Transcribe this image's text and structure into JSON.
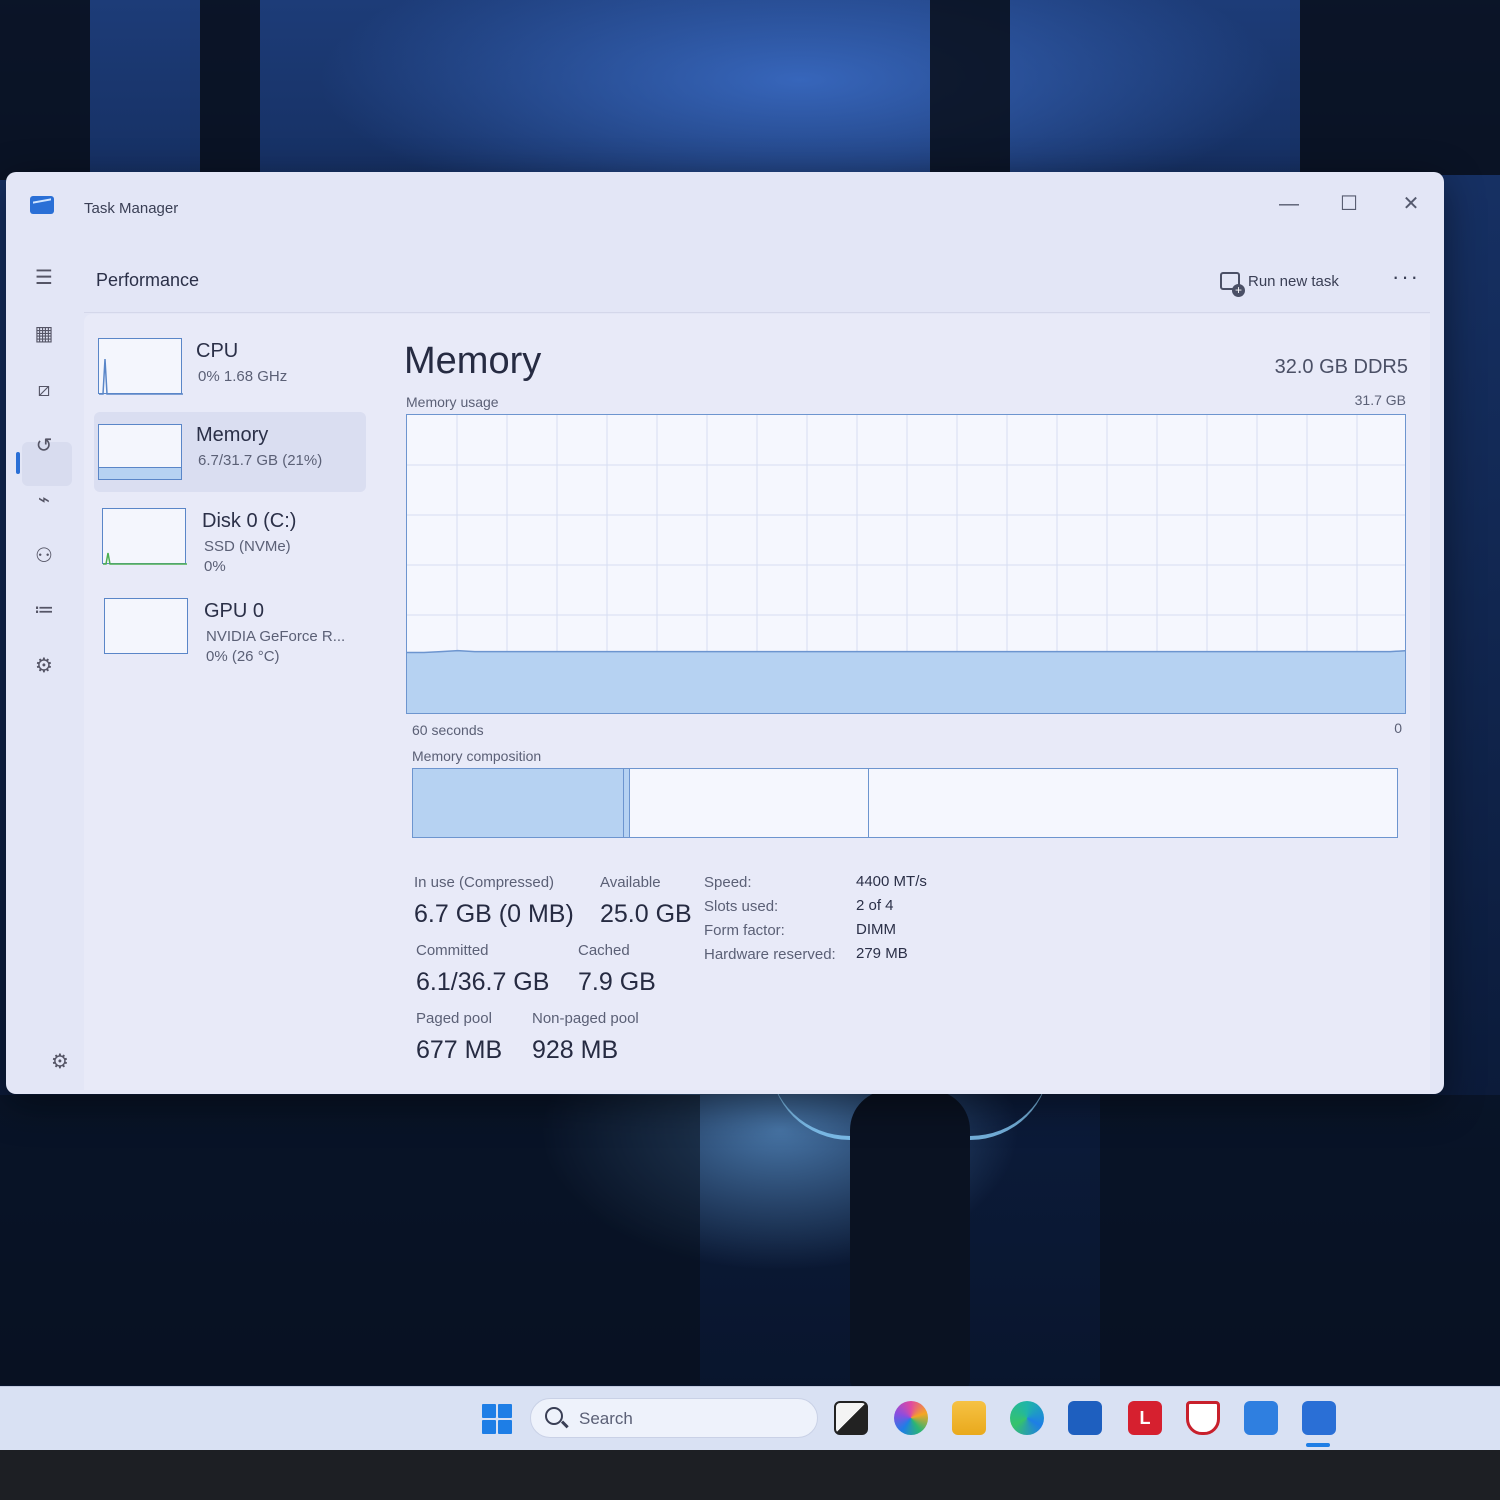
{
  "window": {
    "title": "Task Manager",
    "minimize": "—",
    "maximize": "☐",
    "close": "✕"
  },
  "header": {
    "page_title": "Performance",
    "run_new_task": "Run new task",
    "more": "···"
  },
  "nav": {
    "icons": [
      "hamburger-icon",
      "processes-icon",
      "performance-icon",
      "app-history-icon",
      "startup-apps-icon",
      "users-icon",
      "details-icon",
      "services-icon"
    ],
    "settings_icon": "settings-icon",
    "active": "performance-icon"
  },
  "devices": [
    {
      "name": "CPU",
      "sub1": "0% 1.68 GHz",
      "sub2": ""
    },
    {
      "name": "Memory",
      "sub1": "6.7/31.7 GB (21%)",
      "sub2": "",
      "selected": true
    },
    {
      "name": "Disk 0 (C:)",
      "sub1": "SSD (NVMe)",
      "sub2": "0%"
    },
    {
      "name": "GPU 0",
      "sub1": "NVIDIA GeForce R...",
      "sub2": "0% (26 °C)"
    }
  ],
  "memory": {
    "title": "Memory",
    "spec": "32.0 GB DDR5",
    "usage_label": "Memory usage",
    "usage_max": "31.7 GB",
    "time_left": "60 seconds",
    "time_right": "0",
    "composition_label": "Memory composition",
    "composition": {
      "in_use_fraction": 0.214,
      "modified_fraction": 0.006,
      "standby_fraction": 0.242
    },
    "stats": {
      "in_use_label": "In use (Compressed)",
      "in_use_value": "6.7 GB (0 MB)",
      "available_label": "Available",
      "available_value": "25.0 GB",
      "committed_label": "Committed",
      "committed_value": "6.1/36.7 GB",
      "cached_label": "Cached",
      "cached_value": "7.9 GB",
      "paged_label": "Paged pool",
      "paged_value": "677 MB",
      "nonpaged_label": "Non-paged pool",
      "nonpaged_value": "928 MB"
    },
    "props": {
      "speed_label": "Speed:",
      "speed_value": "4400 MT/s",
      "slots_label": "Slots used:",
      "slots_value": "2 of 4",
      "form_label": "Form factor:",
      "form_value": "DIMM",
      "hw_label": "Hardware reserved:",
      "hw_value": "279 MB"
    }
  },
  "chart_data": {
    "type": "area",
    "title": "Memory usage",
    "xlabel": "",
    "ylabel": "",
    "x_range_seconds": [
      60,
      0
    ],
    "ylim": [
      0,
      31.7
    ],
    "series": [
      {
        "values": [
          6.6,
          6.6,
          6.7,
          6.8,
          6.7,
          6.7,
          6.7,
          6.7,
          6.7,
          6.7,
          6.7,
          6.7,
          6.7,
          6.7,
          6.7,
          6.7,
          6.7,
          6.7,
          6.7,
          6.7,
          6.7,
          6.7,
          6.7,
          6.7,
          6.7,
          6.7,
          6.7,
          6.7,
          6.7,
          6.7,
          6.7,
          6.7,
          6.7,
          6.7,
          6.7,
          6.7,
          6.7,
          6.7,
          6.7,
          6.7,
          6.7,
          6.7,
          6.7,
          6.7,
          6.7,
          6.7,
          6.7,
          6.7,
          6.7,
          6.7,
          6.7,
          6.7,
          6.7,
          6.7,
          6.7,
          6.7,
          6.7,
          6.7,
          6.7,
          6.8
        ]
      }
    ],
    "grid": true
  },
  "taskbar": {
    "search_placeholder": "Search",
    "icons": [
      "start-icon",
      "search-icon",
      "task-view-icon",
      "copilot-icon",
      "file-explorer-icon",
      "edge-icon",
      "store-icon",
      "lenovo-icon",
      "mcafee-icon",
      "app-icon",
      "task-manager-icon"
    ],
    "lenovo_letter": "L"
  },
  "colors": {
    "accent": "#1e7ee6",
    "graph_fill": "#b6d2f2",
    "graph_line": "#6d95cf",
    "window_bg": "#e3e6f6"
  }
}
